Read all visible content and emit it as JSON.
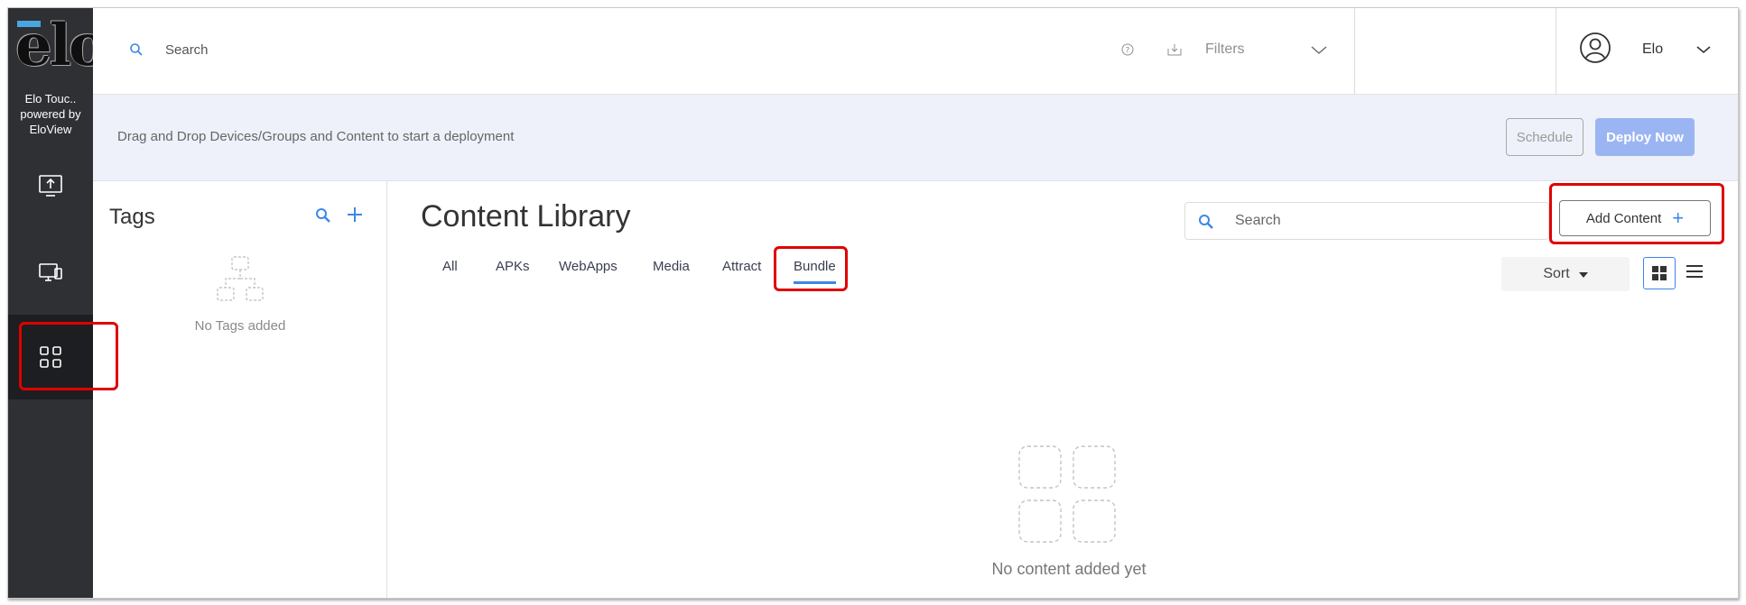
{
  "app": {
    "logo_text": "elo",
    "brand_line1": "Elo Touc..",
    "brand_line2": "powered by",
    "brand_line3": "EloView"
  },
  "rail": {
    "items": [
      {
        "icon": "upload-screen-icon"
      },
      {
        "icon": "devices-icon"
      },
      {
        "icon": "content-grid-icon",
        "active": true
      }
    ]
  },
  "topbar": {
    "search_placeholder": "Search",
    "filters_label": "Filters",
    "user_name": "Elo"
  },
  "banner": {
    "text": "Drag and Drop Devices/Groups and Content to start a deployment",
    "schedule_label": "Schedule",
    "deploy_label": "Deploy Now"
  },
  "tags": {
    "title": "Tags",
    "empty_text": "No Tags added"
  },
  "library": {
    "title": "Content Library",
    "search_placeholder": "Search",
    "add_content_label": "Add Content",
    "tabs": [
      {
        "label": "All"
      },
      {
        "label": "APKs"
      },
      {
        "label": "WebApps"
      },
      {
        "label": "Media"
      },
      {
        "label": "Attract"
      },
      {
        "label": "Bundle",
        "active": true
      }
    ],
    "sort_label": "Sort",
    "empty_text": "No content added yet"
  },
  "colors": {
    "accent": "#3d86e6",
    "rail_bg": "#2f3034",
    "banner_bg": "#eef1f9",
    "deploy_btn": "#9bb5f3",
    "highlight": "#e00000"
  }
}
